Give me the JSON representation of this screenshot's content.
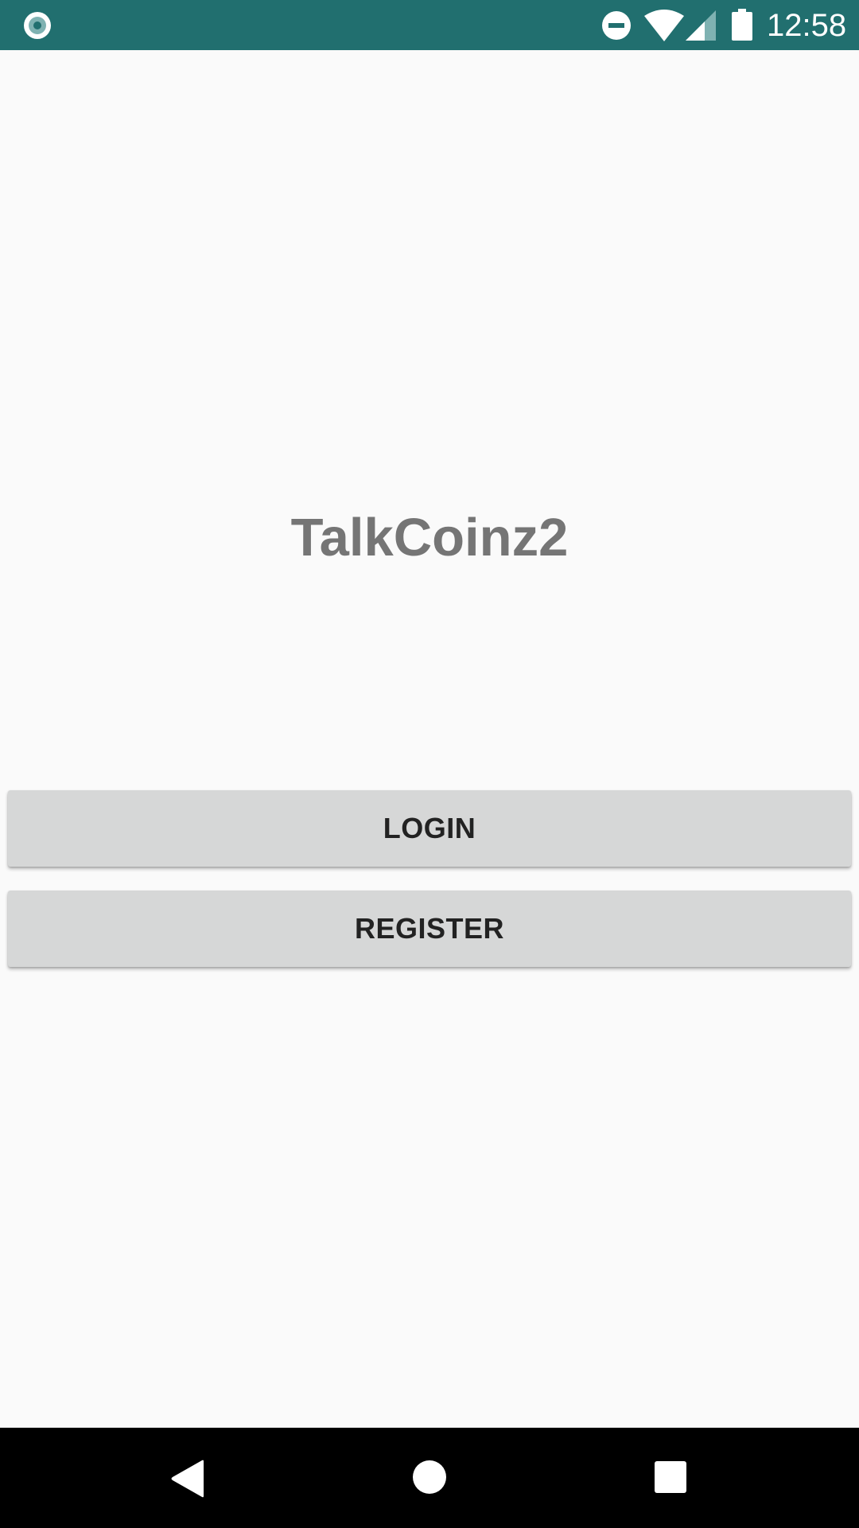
{
  "status_bar": {
    "time": "12:58",
    "icons": [
      "app-notification-icon",
      "do-not-disturb-icon",
      "wifi-icon",
      "cell-signal-icon",
      "battery-icon"
    ],
    "background_color": "#216f6f"
  },
  "main": {
    "title": "TalkCoinz2",
    "login_label": "LOGIN",
    "register_label": "REGISTER"
  },
  "nav_bar": {
    "icons": [
      "back-icon",
      "home-icon",
      "recents-icon"
    ]
  },
  "colors": {
    "title_text": "#757575",
    "button_background": "#d6d7d7",
    "button_text": "#222222",
    "page_background": "#fafafa"
  }
}
